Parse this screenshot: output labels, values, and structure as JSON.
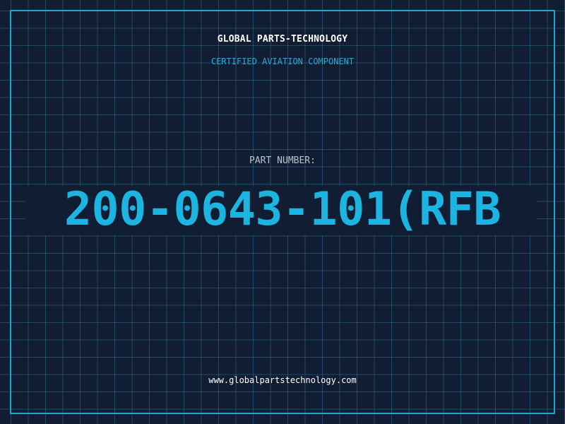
{
  "header": {
    "brand": "GLOBAL PARTS-TECHNOLOGY",
    "subtitle": "CERTIFIED AVIATION COMPONENT"
  },
  "main": {
    "part_label": "PART NUMBER:",
    "part_number": "200-0643-101(RFB"
  },
  "footer": {
    "website": "www.globalpartstechnology.com"
  },
  "colors": {
    "background": "#111d33",
    "grid": "#2e6e8c",
    "frame": "#1ea6d0",
    "accent": "#1cb4e0",
    "text": "#ffffff",
    "label": "#b9c4d0"
  }
}
